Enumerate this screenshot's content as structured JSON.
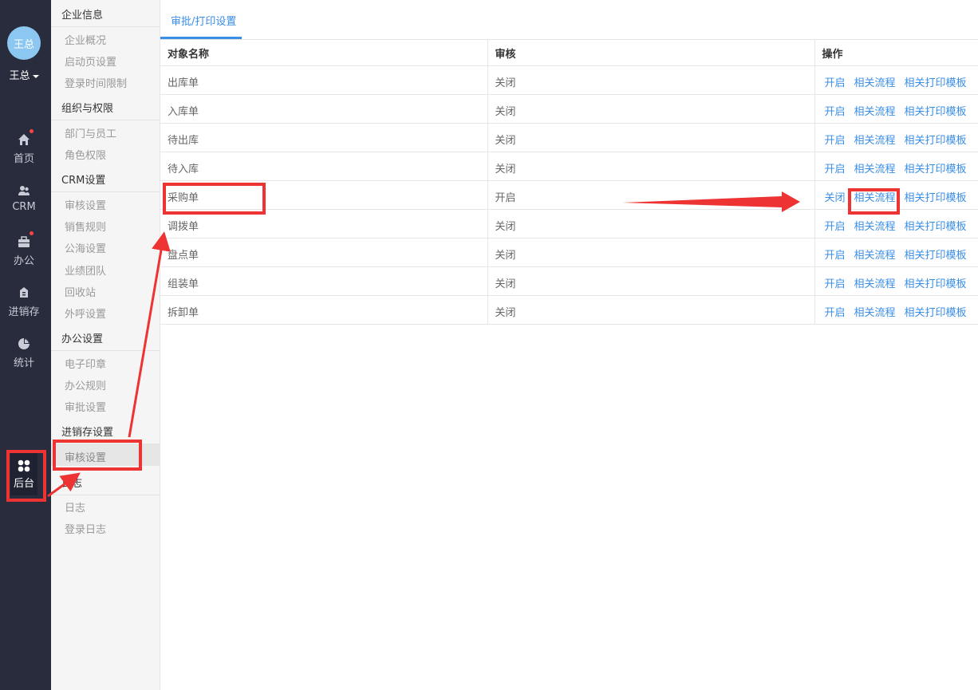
{
  "user": {
    "avatar_text": "王总",
    "name": "王总"
  },
  "nav": [
    {
      "label": "首页",
      "icon": "home-icon",
      "dot": true
    },
    {
      "label": "CRM",
      "icon": "customers-icon",
      "dot": false
    },
    {
      "label": "办公",
      "icon": "briefcase-icon",
      "dot": true
    },
    {
      "label": "进销存",
      "icon": "inventory-icon",
      "dot": false
    },
    {
      "label": "统计",
      "icon": "pie-chart-icon",
      "dot": false
    },
    {
      "label": "后台",
      "icon": "backend-grid-icon",
      "dot": false,
      "active": true
    }
  ],
  "sidebar": {
    "groups": [
      {
        "title": "企业信息",
        "items": [
          "企业概况",
          "启动页设置",
          "登录时间限制"
        ]
      },
      {
        "title": "组织与权限",
        "items": [
          "部门与员工",
          "角色权限"
        ]
      },
      {
        "title": "CRM设置",
        "items": [
          "审核设置",
          "销售规则",
          "公海设置",
          "业绩团队",
          "回收站",
          "外呼设置"
        ]
      },
      {
        "title": "办公设置",
        "items": [
          "电子印章",
          "办公规则",
          "审批设置"
        ]
      },
      {
        "title": "进销存设置",
        "items": [
          "审核设置"
        ]
      },
      {
        "title": "日志",
        "items": [
          "日志",
          "登录日志"
        ]
      }
    ]
  },
  "main": {
    "tab": "审批/打印设置",
    "columns": [
      "对象名称",
      "审核",
      "操作"
    ],
    "rows": [
      {
        "name": "出库单",
        "status": "关闭",
        "toggle": "开启"
      },
      {
        "name": "入库单",
        "status": "关闭",
        "toggle": "开启"
      },
      {
        "name": "待出库",
        "status": "关闭",
        "toggle": "开启"
      },
      {
        "name": "待入库",
        "status": "关闭",
        "toggle": "开启"
      },
      {
        "name": "采购单",
        "status": "开启",
        "toggle": "关闭"
      },
      {
        "name": "调拨单",
        "status": "关闭",
        "toggle": "开启"
      },
      {
        "name": "盘点单",
        "status": "关闭",
        "toggle": "开启"
      },
      {
        "name": "组装单",
        "status": "关闭",
        "toggle": "开启"
      },
      {
        "name": "拆卸单",
        "status": "关闭",
        "toggle": "开启"
      }
    ],
    "op_flow": "相关流程",
    "op_print": "相关打印模板"
  },
  "colors": {
    "accent": "#3a8ee6",
    "nav_bg": "#282c3c",
    "annotation": "#ee3333"
  }
}
